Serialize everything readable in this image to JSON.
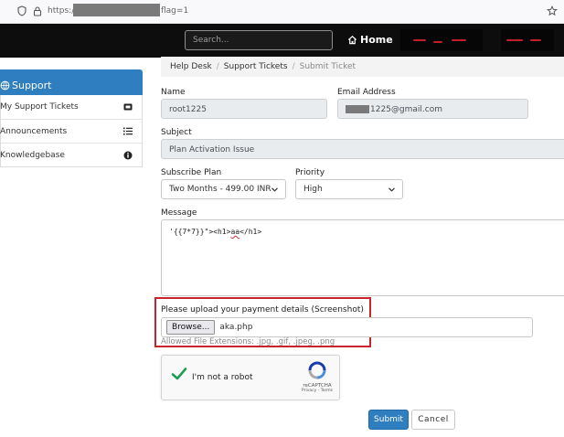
{
  "browser": {
    "url_prefix": "https://",
    "url_suffix": "flag=1"
  },
  "nav": {
    "search_placeholder": "Search...",
    "home_label": "Home"
  },
  "sidebar": {
    "title": "Support",
    "items": [
      {
        "label": "My Support Tickets",
        "icon": "ticket-icon"
      },
      {
        "label": "Announcements",
        "icon": "list-icon"
      },
      {
        "label": "Knowledgebase",
        "icon": "info-icon"
      }
    ]
  },
  "breadcrumb": {
    "items": [
      "Help Desk",
      "Support Tickets",
      "Submit Ticket"
    ]
  },
  "form": {
    "name_label": "Name",
    "name_value": "root1225",
    "email_label": "Email Address",
    "email_value_suffix": "1225@gmail.com",
    "subject_label": "Subject",
    "subject_value": "Plan Activation Issue",
    "plan_label": "Subscribe Plan",
    "plan_value": "Two Months - 499.00 INR",
    "priority_label": "Priority",
    "priority_value": "High",
    "message_label": "Message",
    "message_prefix": "'{{7*7}}\"><h1>",
    "message_marked": "aa",
    "message_suffix": "</h1>",
    "upload_label": "Please upload your payment details (Screenshot)",
    "browse_label": "Browse...",
    "file_name": "aka.php",
    "allowed_ext": "Allowed File Extensions: .jpg, .gif, .jpeg, .png"
  },
  "captcha": {
    "text": "I'm not a robot",
    "brand": "reCAPTCHA",
    "links": "Privacy - Terms"
  },
  "buttons": {
    "submit": "Submit",
    "cancel": "Cancel"
  },
  "colors": {
    "accent": "#2f7ebf",
    "highlight": "#c9242c",
    "nav_bg": "#0d0d0d"
  }
}
